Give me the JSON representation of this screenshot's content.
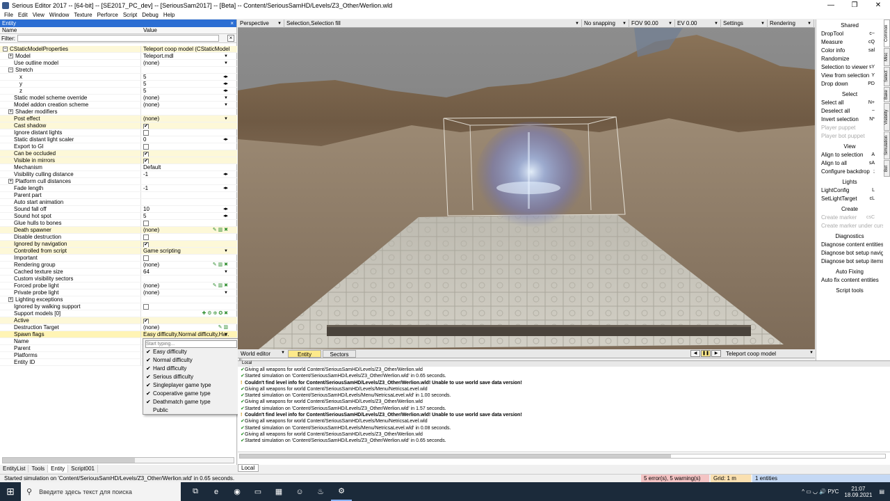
{
  "title": "Serious Editor 2017 -- [64-bit] -- [SE2017_PC_dev] -- [SeriousSam2017] -- [Beta] -- Content/SeriousSamHD/Levels/Z3_Other/Werlion.wld",
  "window_buttons": {
    "minimize": "—",
    "maximize": "❐",
    "close": "✕"
  },
  "menu": [
    "File",
    "Edit",
    "View",
    "Window",
    "Texture",
    "Perforce",
    "Script",
    "Debug",
    "Help"
  ],
  "entity_panel": {
    "title": "Entity",
    "close": "×",
    "col_name": "Name",
    "col_value": "Value",
    "filter_label": "Filter:",
    "filter_clear": "×",
    "rows": [
      {
        "n": "CStaticModelProperties",
        "v": "Teleport coop model (CStaticModelProper",
        "exp": "−",
        "ind": 0,
        "bg": "y"
      },
      {
        "n": "Model",
        "v": "Teleport.mdl",
        "exp": "+",
        "ind": 1,
        "dd": true
      },
      {
        "n": "Use outline model",
        "v": "(none)",
        "ind": 2,
        "dd": true
      },
      {
        "n": "Stretch",
        "v": "",
        "exp": "−",
        "ind": 1
      },
      {
        "n": "x",
        "v": "5",
        "ind": 3,
        "arr": true
      },
      {
        "n": "y",
        "v": "5",
        "ind": 3,
        "arr": true
      },
      {
        "n": "z",
        "v": "5",
        "ind": 3,
        "arr": true
      },
      {
        "n": "Static model scheme override",
        "v": "(none)",
        "ind": 2,
        "dd": true
      },
      {
        "n": "Model addon creation scheme",
        "v": "(none)",
        "ind": 2,
        "dd": true
      },
      {
        "n": "Shader modifiers",
        "v": "",
        "exp": "+",
        "ind": 1
      },
      {
        "n": "Post effect",
        "v": "(none)",
        "ind": 2,
        "dd": true,
        "bg": "y"
      },
      {
        "n": "Cast shadow",
        "chk": "✔",
        "ind": 2,
        "bg": "y"
      },
      {
        "n": "Ignore distant lights",
        "chk": "",
        "ind": 2
      },
      {
        "n": "Static distant light scaler",
        "v": "0",
        "ind": 2,
        "arr": true
      },
      {
        "n": "Export to GI",
        "chk": "",
        "ind": 2
      },
      {
        "n": "Can be occluded",
        "chk": "✔",
        "ind": 2,
        "bg": "y"
      },
      {
        "n": "Visible in mirrors",
        "chk": "✔",
        "ind": 2,
        "bg": "y"
      },
      {
        "n": "Mechanism",
        "v": "Default",
        "ind": 2
      },
      {
        "n": "Visibility culling distance",
        "v": "-1",
        "ind": 2,
        "arr": true
      },
      {
        "n": "Platform cull distances",
        "v": "",
        "exp": "+",
        "ind": 1
      },
      {
        "n": "Fade length",
        "v": "-1",
        "ind": 2,
        "arr": true
      },
      {
        "n": "Parent part",
        "v": "",
        "ind": 2
      },
      {
        "n": "Auto start animation",
        "v": "",
        "ind": 2
      },
      {
        "n": "Sound fall off",
        "v": "10",
        "ind": 2,
        "arr": true
      },
      {
        "n": "Sound hot spot",
        "v": "5",
        "ind": 2,
        "arr": true
      },
      {
        "n": "Glue hulls to bones",
        "chk": "",
        "ind": 2
      },
      {
        "n": "Death spawner",
        "v": "(none)",
        "ind": 2,
        "acts": "✎ ▥ ✖",
        "bg": "y"
      },
      {
        "n": "Disable destruction",
        "chk": "",
        "ind": 2
      },
      {
        "n": "Ignored by navigation",
        "chk": "✔",
        "ind": 2,
        "bg": "y"
      },
      {
        "n": "Controlled from script",
        "v": "Game scripting",
        "ind": 2,
        "dd": true,
        "bg": "y"
      },
      {
        "n": "Important",
        "chk": "",
        "ind": 2
      },
      {
        "n": "Rendering group",
        "v": "(none)",
        "ind": 2,
        "acts": "✎ ▥ ✖"
      },
      {
        "n": "Cached texture size",
        "v": "64",
        "ind": 2,
        "dd": true
      },
      {
        "n": "Custom visibility sectors",
        "v": "",
        "ind": 2
      },
      {
        "n": "Forced probe light",
        "v": "(none)",
        "ind": 2,
        "acts": "✎ ▥ ✖"
      },
      {
        "n": "Private probe light",
        "v": "(none)",
        "ind": 2,
        "dd": true
      },
      {
        "n": "Lighting exceptions",
        "v": "",
        "exp": "+",
        "ind": 1
      },
      {
        "n": "Ignored by walking support",
        "chk": "",
        "ind": 2
      },
      {
        "n": "Support models [0]",
        "v": "",
        "ind": 2,
        "acts": "✚ ⚙ ⊕ ✪ ✖"
      },
      {
        "n": "Active",
        "chk": "✔",
        "ind": 2,
        "bg": "y"
      },
      {
        "n": "Destruction Target",
        "v": "(none)",
        "ind": 2,
        "acts": "✎ ▥"
      },
      {
        "n": "Spawn flags",
        "v": "Easy difficulty,Normal difficulty,Har...",
        "ind": 2,
        "dd": true,
        "bg": "h"
      },
      {
        "n": "Name",
        "v": "",
        "ind": 2
      },
      {
        "n": "Parent",
        "v": "",
        "ind": 2
      },
      {
        "n": "Platforms",
        "v": "",
        "ind": 2
      },
      {
        "n": "Entity ID",
        "v": "",
        "ind": 2
      }
    ],
    "dropdown": {
      "placeholder": "Start typing...",
      "options": [
        {
          "label": "Easy difficulty",
          "checked": "✔"
        },
        {
          "label": "Normal difficulty",
          "checked": "✔"
        },
        {
          "label": "Hard difficulty",
          "checked": "✔"
        },
        {
          "label": "Serious difficulty",
          "checked": "✔"
        },
        {
          "label": "Singleplayer game type",
          "checked": "✔"
        },
        {
          "label": "Cooperative game type",
          "checked": "✔"
        },
        {
          "label": "Deathmatch game type",
          "checked": "✔"
        },
        {
          "label": "Public",
          "checked": ""
        }
      ]
    },
    "tabs": [
      "EntityList",
      "Tools",
      "Entity",
      "Script001"
    ]
  },
  "viewport": {
    "toolbar": {
      "projection": "Perspective",
      "selection": "Selection,Selection fill",
      "snapping": "No snapping",
      "fov": "FOV 90.00",
      "ev": "EV  0.00",
      "settings": "Settings",
      "rendering": "Rendering"
    },
    "mode": "World editor",
    "tab_entity": "Entity",
    "tab_sectors": "Sectors",
    "play_prev": "◀",
    "play_pause": "❚❚",
    "play_next": "▶",
    "selected_entity": "Teleport coop model"
  },
  "tools_panel": {
    "tabs": [
      "Common",
      "Misc",
      "Select",
      "Bake",
      "Visibility",
      "Simulation",
      "Bot"
    ],
    "sections": [
      {
        "title": "Shared",
        "items": [
          {
            "label": "DropTool",
            "sc": "c~"
          },
          {
            "label": "Measure",
            "sc": "cQ"
          },
          {
            "label": "Color info",
            "sc": "sal"
          },
          {
            "label": "Randomize",
            "sc": ""
          },
          {
            "label": "Selection to viewer",
            "sc": "sY"
          },
          {
            "label": "View from selection",
            "sc": "Y"
          },
          {
            "label": "Drop down",
            "sc": "PD"
          }
        ]
      },
      {
        "title": "Select",
        "items": [
          {
            "label": "Select all",
            "sc": "N+"
          },
          {
            "label": "Deselect all",
            "sc": "~"
          },
          {
            "label": "Invert selection",
            "sc": "N*"
          },
          {
            "label": "Player puppet",
            "sc": "",
            "dis": true
          },
          {
            "label": "Player bot puppet",
            "sc": "",
            "dis": true
          }
        ]
      },
      {
        "title": "View",
        "items": [
          {
            "label": "Align to selection",
            "sc": "A"
          },
          {
            "label": "Align to all",
            "sc": "sA"
          },
          {
            "label": "Configure backdrop",
            "sc": ";"
          }
        ]
      },
      {
        "title": "Lights",
        "items": [
          {
            "label": "LightConfig",
            "sc": "L"
          },
          {
            "label": "SetLightTarget",
            "sc": "cL"
          }
        ]
      },
      {
        "title": "Create",
        "items": [
          {
            "label": "Create marker",
            "sc": "csC",
            "dis": true
          },
          {
            "label": "Create marker under cursor",
            "sc": "",
            "dis": true
          }
        ]
      },
      {
        "title": "Diagnostics",
        "items": [
          {
            "label": "Diagnose content entities",
            "sc": ""
          },
          {
            "label": "Diagnose bot setup navigation",
            "sc": ""
          },
          {
            "label": "Diagnose bot setup items",
            "sc": ""
          }
        ]
      },
      {
        "title": "Auto Fixing",
        "items": [
          {
            "label": "Auto fix content entities",
            "sc": ""
          }
        ]
      },
      {
        "title": "Script tools",
        "items": []
      }
    ]
  },
  "log": {
    "header": "Local",
    "lines": [
      {
        "t": "Giving all weapons for world Content/SeriousSamHD/Levels/Z3_Other/Werlion.wld",
        "ic": "✔"
      },
      {
        "t": "Started simulation on 'Content/SeriousSamHD/Levels/Z3_Other/Werlion.wld' in 0.65 seconds.",
        "ic": "✔"
      },
      {
        "t": "Couldn't find level info for Content/SeriousSamHD/Levels/Z3_Other/Werlion.wld! Unable to use world save data version!",
        "ic": "!",
        "bold": true
      },
      {
        "t": "Giving all weapons for world Content/SeriousSamHD/Levels/Menu/NetricsaLevel.wld",
        "ic": "✔"
      },
      {
        "t": "Started simulation on 'Content/SeriousSamHD/Levels/Menu/NetricsaLevel.wld' in 1.00 seconds.",
        "ic": "✔"
      },
      {
        "t": "Giving all weapons for world Content/SeriousSamHD/Levels/Z3_Other/Werlion.wld",
        "ic": "✔"
      },
      {
        "t": "Started simulation on 'Content/SeriousSamHD/Levels/Z3_Other/Werlion.wld' in 1.57 seconds.",
        "ic": "✔"
      },
      {
        "t": "Couldn't find level info for Content/SeriousSamHD/Levels/Z3_Other/Werlion.wld! Unable to use world save data version!",
        "ic": "!",
        "bold": true
      },
      {
        "t": "Giving all weapons for world Content/SeriousSamHD/Levels/Menu/NetricsaLevel.wld",
        "ic": "✔"
      },
      {
        "t": "Started simulation on 'Content/SeriousSamHD/Levels/Menu/NetricsaLevel.wld' in 0.08 seconds.",
        "ic": "✔"
      },
      {
        "t": "Giving all weapons for world Content/SeriousSamHD/Levels/Z3_Other/Werlion.wld",
        "ic": "✔"
      },
      {
        "t": "Started simulation on 'Content/SeriousSamHD/Levels/Z3_Other/Werlion.wld' in 0.65 seconds.",
        "ic": "✔"
      }
    ],
    "tab": "Local"
  },
  "status": {
    "message": "Started simulation on 'Content/SeriousSamHD/Levels/Z3_Other/Werlion.wld' in 0.65 seconds.",
    "errors": "5 error(s), 5 warning(s)",
    "grid": "Grid: 1 m",
    "entities": "1 entities"
  },
  "taskbar": {
    "start": "⊞",
    "search_placeholder": "Введите здесь текст для поиска",
    "search_icon": "⚲",
    "apps": [
      "⧉",
      "e",
      "◉",
      "▭",
      "▦",
      "☺",
      "♨",
      "⚙"
    ],
    "tray": "^  ▭  ◡  🔊  РУС",
    "time": "21:07",
    "date": "18.09.2021",
    "notif": "▤"
  },
  "colors": {
    "title_bar": "#2b6ed3",
    "highlight": "#fde98a",
    "error_bg": "#f4c4c4",
    "grid_bg": "#fae0b0",
    "entities_bg": "#c4d8f4"
  }
}
